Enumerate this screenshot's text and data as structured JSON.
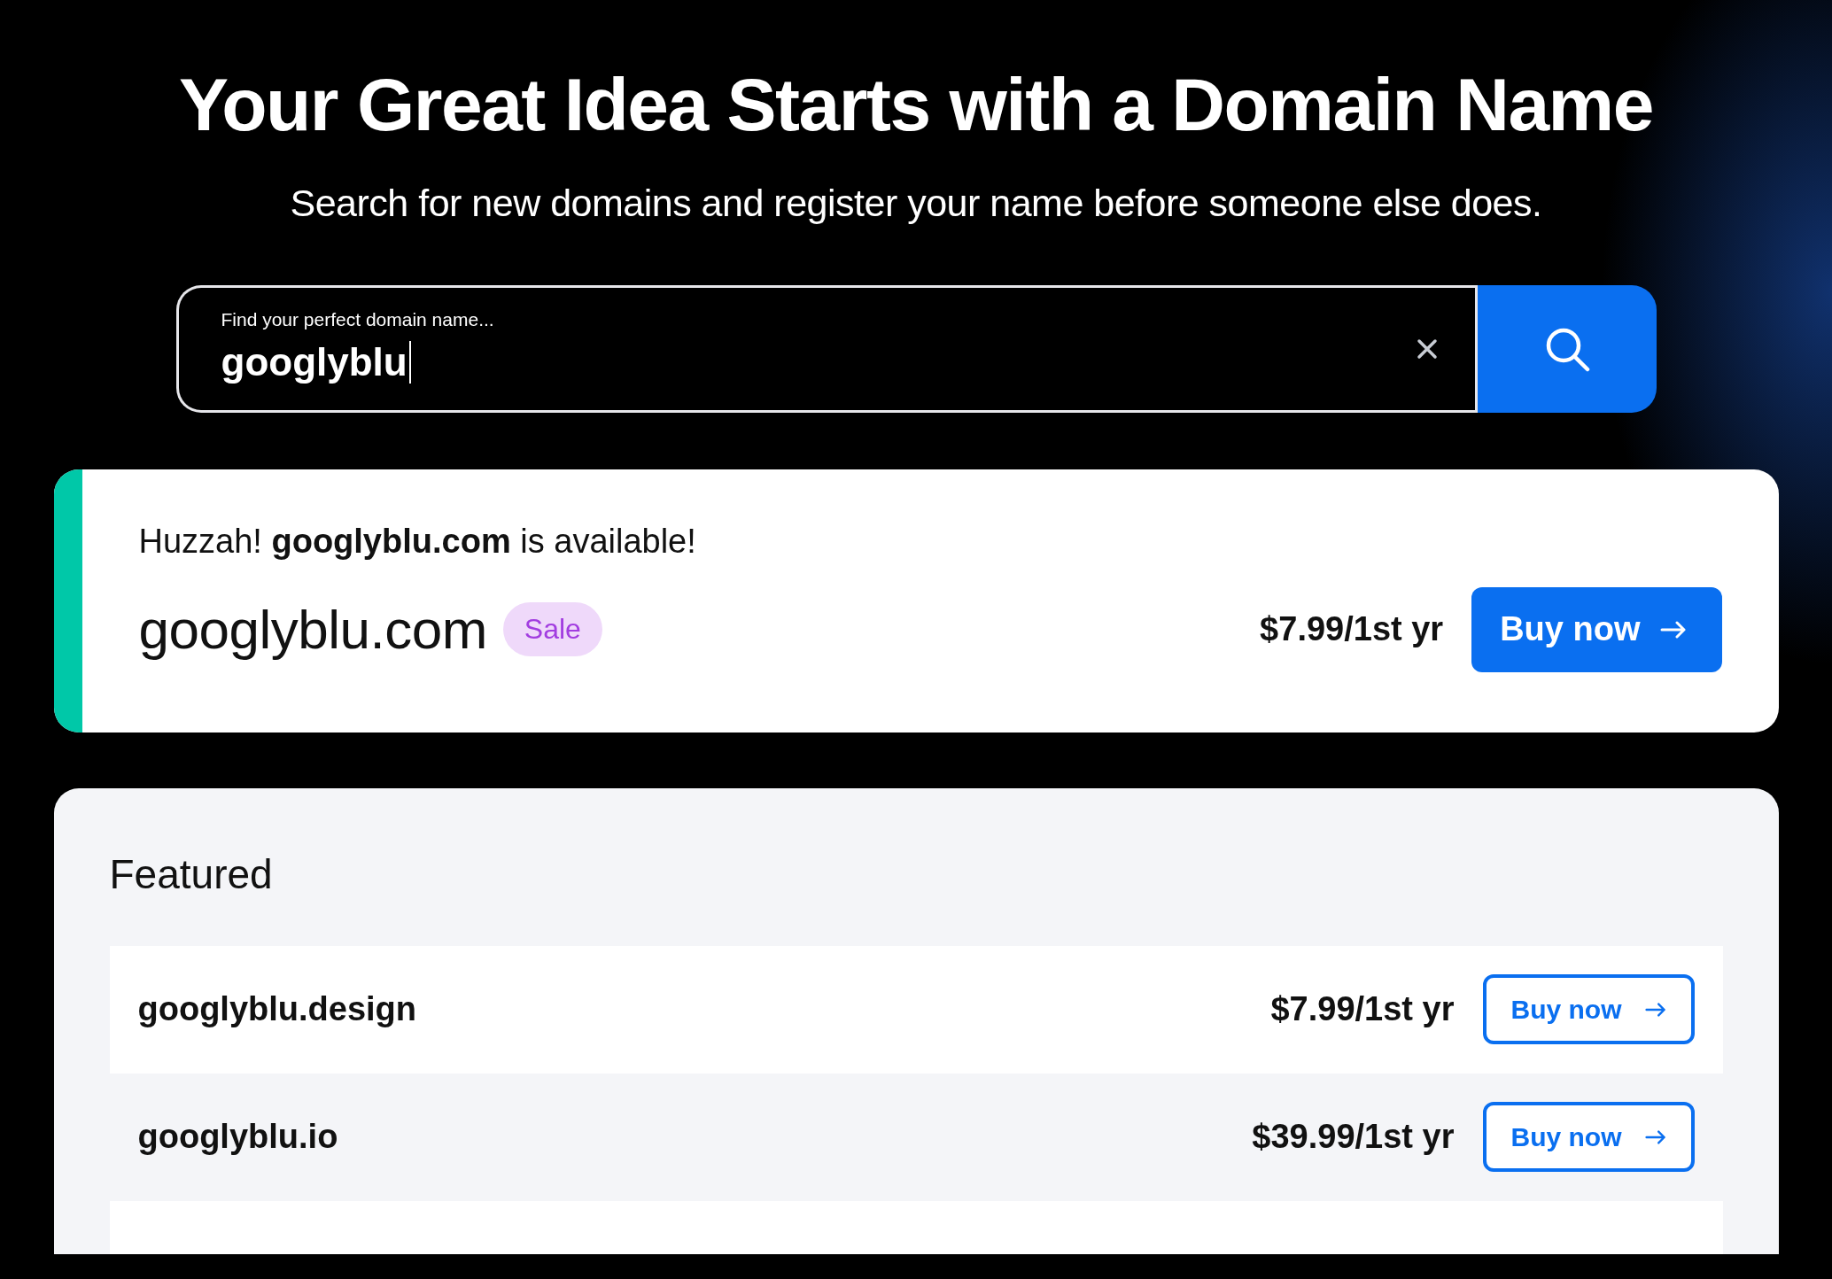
{
  "hero": {
    "title": "Your Great Idea Starts with a Domain Name",
    "subtitle": "Search for new domains and register your name before someone else does."
  },
  "search": {
    "label": "Find your perfect domain name...",
    "value": "googlyblu"
  },
  "result": {
    "message": "Huzzah! **googlyblu.com** is available!",
    "domain": "googlyblu.com",
    "badge": "Sale",
    "price": "$7.99/1st yr",
    "button": {
      "label": "Buy now",
      "kind": "primary"
    }
  },
  "featured": {
    "heading": "Featured",
    "rows": [
      {
        "domain": "googlyblu.design",
        "price": "$7.99/1st yr",
        "button": {
          "label": "Buy now",
          "kind": "outline"
        }
      },
      {
        "domain": "googlyblu.io",
        "price": "$39.99/1st yr",
        "button": {
          "label": "Buy now",
          "kind": "outline"
        }
      }
    ]
  }
}
